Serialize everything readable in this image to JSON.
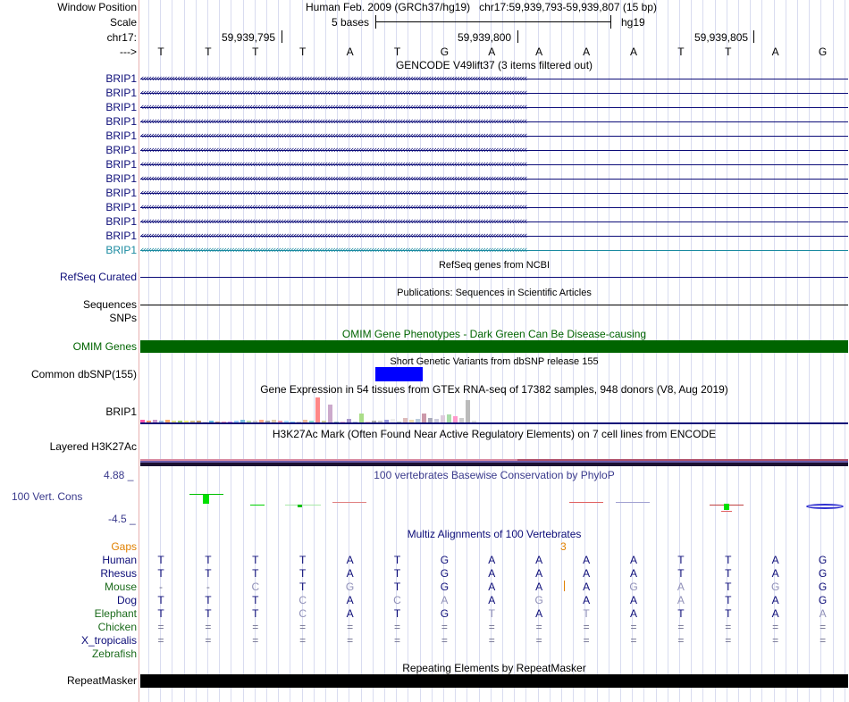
{
  "header": {
    "window_position_label": "Window Position",
    "assembly": "Human Feb. 2009 (GRCh37/hg19)",
    "position": "chr17:59,939,793-59,939,807 (15 bp)",
    "scale_label": "Scale",
    "scale_text": "5 bases",
    "db": "hg19",
    "chrom_label": "chr17:",
    "ticks": [
      "59,939,795",
      "59,939,800",
      "59,939,805"
    ],
    "strand_label": "--->"
  },
  "dna": [
    "T",
    "T",
    "T",
    "T",
    "A",
    "T",
    "G",
    "A",
    "A",
    "A",
    "A",
    "T",
    "T",
    "A",
    "G"
  ],
  "gencode": {
    "title": "GENCODE V49lift37 (3 items filtered out)",
    "genes": [
      "BRIP1",
      "BRIP1",
      "BRIP1",
      "BRIP1",
      "BRIP1",
      "BRIP1",
      "BRIP1",
      "BRIP1",
      "BRIP1",
      "BRIP1",
      "BRIP1",
      "BRIP1",
      "BRIP1"
    ]
  },
  "refseq": {
    "title": "RefSeq genes from NCBI",
    "label": "RefSeq Curated"
  },
  "publications": {
    "title": "Publications: Sequences in Scientific Articles",
    "label": "Sequences"
  },
  "snps": {
    "label": "SNPs"
  },
  "omim": {
    "title": "OMIM Gene Phenotypes - Dark Green Can Be Disease-causing",
    "label": "OMIM Genes",
    "color": "#006400"
  },
  "dbsnp": {
    "title": "Short Genetic Variants from dbSNP release 155",
    "label": "Common dbSNP(155)",
    "color": "#0000ff"
  },
  "gtex": {
    "title": "Gene Expression in 54 tissues from GTEx RNA-seq of 17382 samples, 948 donors (V8, Aug 2019)",
    "label": "BRIP1"
  },
  "h3k27ac": {
    "title": "H3K27Ac Mark (Often Found Near Active Regulatory Elements) on 7 cell lines from ENCODE",
    "label": "Layered H3K27Ac"
  },
  "phylop": {
    "title": "100 vertebrates Basewise Conservation by PhyloP",
    "label": "100 Vert. Cons",
    "max": "4.88 _",
    "min": "-4.5 _"
  },
  "multiz": {
    "title": "Multiz Alignments of 100 Vertebrates",
    "gaps_label": "Gaps",
    "gap_count": "3",
    "species": [
      {
        "name": "Human",
        "seq": [
          "T",
          "T",
          "T",
          "T",
          "A",
          "T",
          "G",
          "A",
          "A",
          "A",
          "A",
          "T",
          "T",
          "A",
          "G"
        ]
      },
      {
        "name": "Rhesus",
        "seq": [
          "T",
          "T",
          "T",
          "T",
          "A",
          "T",
          "G",
          "A",
          "A",
          "A",
          "A",
          "T",
          "T",
          "A",
          "G"
        ]
      },
      {
        "name": "Mouse",
        "seq": [
          "-",
          "-",
          "C",
          "T",
          "G",
          "T",
          "G",
          "A",
          "A",
          "A",
          "G",
          "A",
          "T",
          "G",
          "G"
        ]
      },
      {
        "name": "Dog",
        "seq": [
          "T",
          "T",
          "T",
          "C",
          "A",
          "C",
          "A",
          "A",
          "G",
          "A",
          "A",
          "A",
          "T",
          "A",
          "G"
        ]
      },
      {
        "name": "Elephant",
        "seq": [
          "T",
          "T",
          "T",
          "C",
          "A",
          "T",
          "G",
          "T",
          "A",
          "T",
          "A",
          "T",
          "T",
          "A",
          "A"
        ]
      },
      {
        "name": "Chicken",
        "seq": [
          "=",
          "=",
          "=",
          "=",
          "=",
          "=",
          "=",
          "=",
          "=",
          "=",
          "=",
          "=",
          "=",
          "=",
          "="
        ]
      },
      {
        "name": "X_tropicalis",
        "seq": [
          "=",
          "=",
          "=",
          "=",
          "=",
          "=",
          "=",
          "=",
          "=",
          "=",
          "=",
          "=",
          "=",
          "=",
          "="
        ]
      },
      {
        "name": "Zebrafish",
        "seq": []
      }
    ]
  },
  "repeatmasker": {
    "title": "Repeating Elements by RepeatMasker",
    "label": "RepeatMasker"
  }
}
